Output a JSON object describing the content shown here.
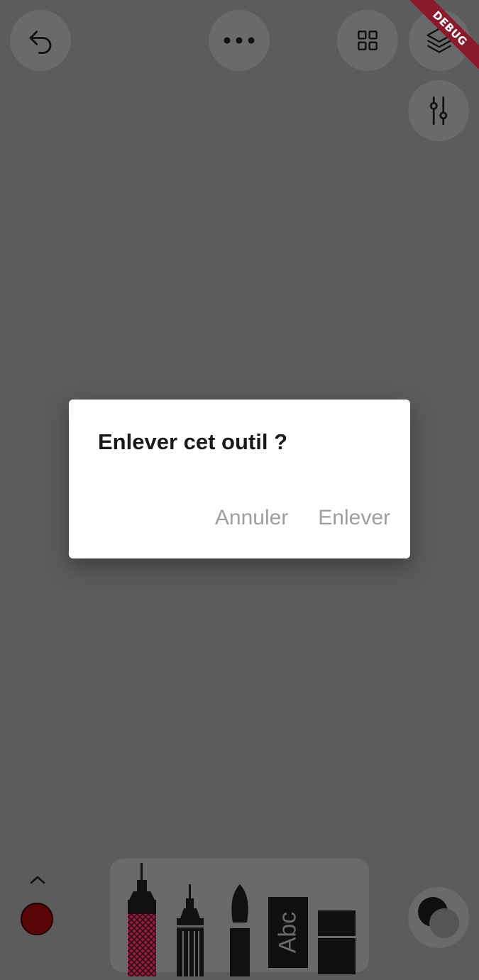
{
  "debug_badge": "DEBUG",
  "toolbar": {
    "undo_icon": "undo-icon",
    "more_icon": "more-horizontal-icon",
    "grid_icon": "grid-icon",
    "layers_icon": "layers-icon",
    "adjust_icon": "sliders-icon"
  },
  "dialog": {
    "title": "Enlever cet outil ?",
    "cancel_label": "Annuler",
    "confirm_label": "Enlever"
  },
  "bottom": {
    "current_color": "#5a0606",
    "tools": [
      "pen",
      "fineliner",
      "brush",
      "text",
      "eraser"
    ],
    "text_tool_label": "Abc"
  },
  "colors": {
    "overlay_background": "#5c5c5c",
    "button_background": "#6a6a6a",
    "dialog_button_text": "#9e9e9e",
    "pen_accent": "#a0153e"
  }
}
